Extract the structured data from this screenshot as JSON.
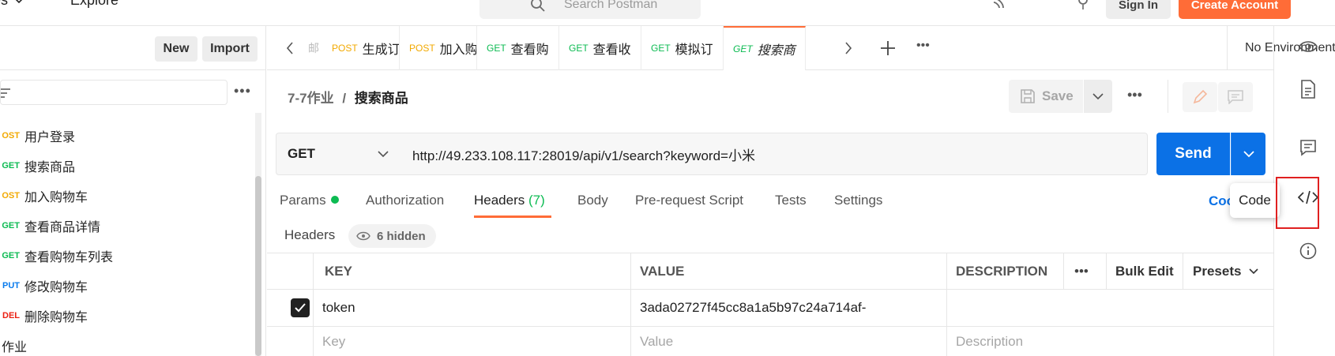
{
  "topbar": {
    "workspaces": "ces",
    "explore": "Explore",
    "search_placeholder": "Search Postman",
    "signin": "Sign In",
    "create_account": "Create Account"
  },
  "sidebar": {
    "new": "New",
    "import": "Import",
    "more": "•••",
    "items": [
      {
        "method": "OST",
        "name": "用户登录",
        "color": "#f2a900"
      },
      {
        "method": "GET",
        "name": "搜索商品",
        "color": "#0cbb52"
      },
      {
        "method": "OST",
        "name": "加入购物车",
        "color": "#f2a900"
      },
      {
        "method": "GET",
        "name": "查看商品详情",
        "color": "#0cbb52"
      },
      {
        "method": "GET",
        "name": "查看购物车列表",
        "color": "#0cbb52"
      },
      {
        "method": "PUT",
        "name": "修改购物车",
        "color": "#097bed"
      },
      {
        "method": "DEL",
        "name": "删除购物车",
        "color": "#eb2013"
      }
    ],
    "folder": "作业"
  },
  "tabs": {
    "partial": "邮",
    "items": [
      {
        "method": "POST",
        "name": "生成订",
        "color": "#f2a900"
      },
      {
        "method": "POST",
        "name": "加入购",
        "color": "#f2a900"
      },
      {
        "method": "GET",
        "name": "查看购",
        "color": "#0cbb52"
      },
      {
        "method": "GET",
        "name": "查看收",
        "color": "#0cbb52"
      },
      {
        "method": "GET",
        "name": "模拟订",
        "color": "#0cbb52"
      },
      {
        "method": "GET",
        "name": "搜索商",
        "color": "#0cbb52"
      }
    ],
    "environment": "No Environment"
  },
  "request": {
    "collection": "7-7作业",
    "separator": "/",
    "name": "搜索商品",
    "save": "Save",
    "method": "GET",
    "url": "http://49.233.108.117:28019/api/v1/search?keyword=小米",
    "send": "Send"
  },
  "req_tabs": {
    "params": "Params",
    "authorization": "Authorization",
    "headers": "Headers",
    "headers_count": "(7)",
    "body": "Body",
    "prerequest": "Pre-request Script",
    "tests": "Tests",
    "settings": "Settings",
    "cookies": "Coo"
  },
  "tooltip": "Code",
  "headers_section": {
    "label": "Headers",
    "hidden": "6 hidden",
    "col_key": "KEY",
    "col_value": "VALUE",
    "col_description": "DESCRIPTION",
    "more": "•••",
    "bulk_edit": "Bulk Edit",
    "presets": "Presets",
    "rows": [
      {
        "key": "token",
        "value": "3ada02727f45cc8a1a5b97c24a714af-",
        "checked": true
      }
    ],
    "placeholder_key": "Key",
    "placeholder_value": "Value",
    "placeholder_description": "Description"
  }
}
